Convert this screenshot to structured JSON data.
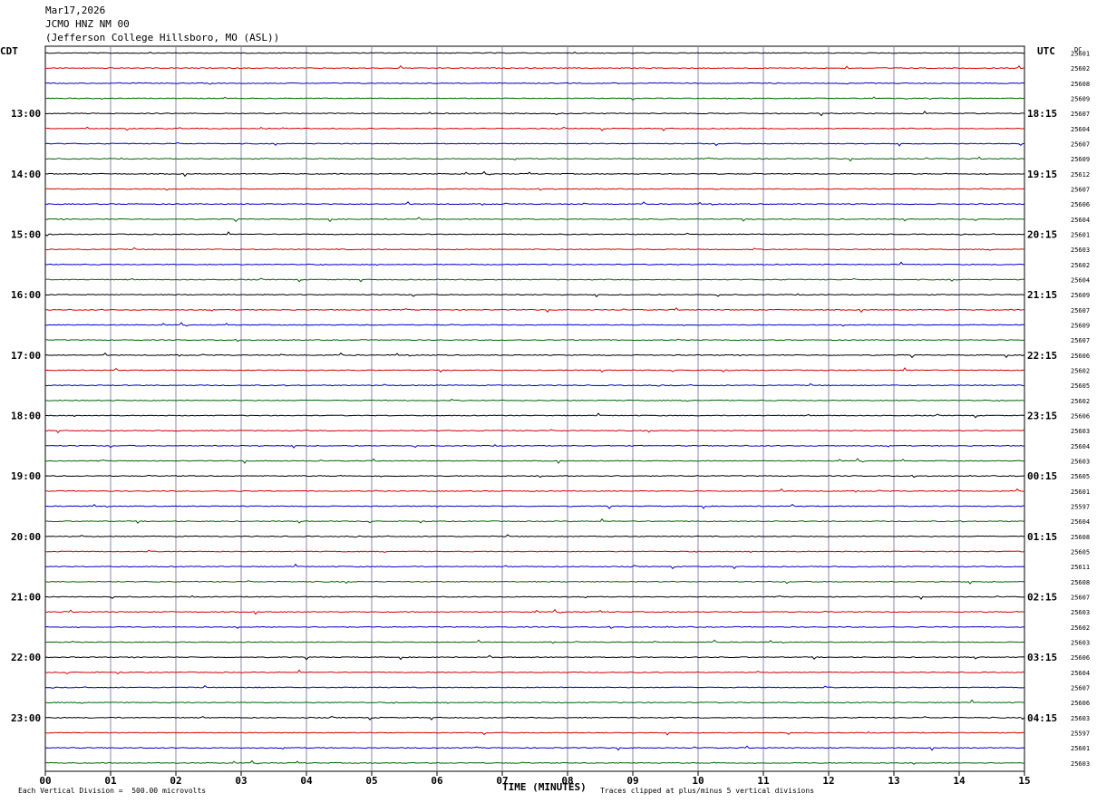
{
  "header": {
    "date": "Mar17,2026",
    "station": "JCMO HNZ NM 00",
    "location": "(Jefferson College Hillsboro, MO (ASL))"
  },
  "chart_data": {
    "type": "line",
    "title": "Mar17,2026",
    "left_axis_label": "CDT",
    "right_axis_label": "UTC",
    "dc_label": "DC",
    "xlabel": "TIME (MINUTES)",
    "xlim": [
      0,
      15
    ],
    "x_ticks": [
      "00",
      "01",
      "02",
      "03",
      "04",
      "05",
      "06",
      "07",
      "08",
      "09",
      "10",
      "11",
      "12",
      "13",
      "14",
      "15"
    ],
    "left_time_labels": [
      "13:00",
      "14:00",
      "15:00",
      "16:00",
      "17:00",
      "18:00",
      "19:00",
      "20:00",
      "21:00",
      "22:00",
      "23:00"
    ],
    "right_time_labels": [
      "18:15",
      "19:15",
      "20:15",
      "21:15",
      "22:15",
      "23:15",
      "00:15",
      "01:15",
      "02:15",
      "03:15",
      "04:15"
    ],
    "trace_colors": [
      "#000000",
      "#d40000",
      "#0000c8",
      "#006400"
    ],
    "dc_values": [
      "25601",
      "25602",
      "25608",
      "25609",
      "25607",
      "25604",
      "25607",
      "25609",
      "25612",
      "25607",
      "25606",
      "25604",
      "25601",
      "25603",
      "25602",
      "25604",
      "25609",
      "25607",
      "25609",
      "25607",
      "25606",
      "25602",
      "25605",
      "25602",
      "25606",
      "25603",
      "25604",
      "25603",
      "25605",
      "25601",
      "25597",
      "25604",
      "25608",
      "25605",
      "25611",
      "25608",
      "25607",
      "25603",
      "25602",
      "25603",
      "25606",
      "25604",
      "25607",
      "25606",
      "25603",
      "25597",
      "25601",
      "25603"
    ],
    "grid": true,
    "footer_left": "Each Vertical Division =  500.00 microvolts",
    "footer_right": "Traces clipped at plus/minus 5 vertical divisions"
  }
}
